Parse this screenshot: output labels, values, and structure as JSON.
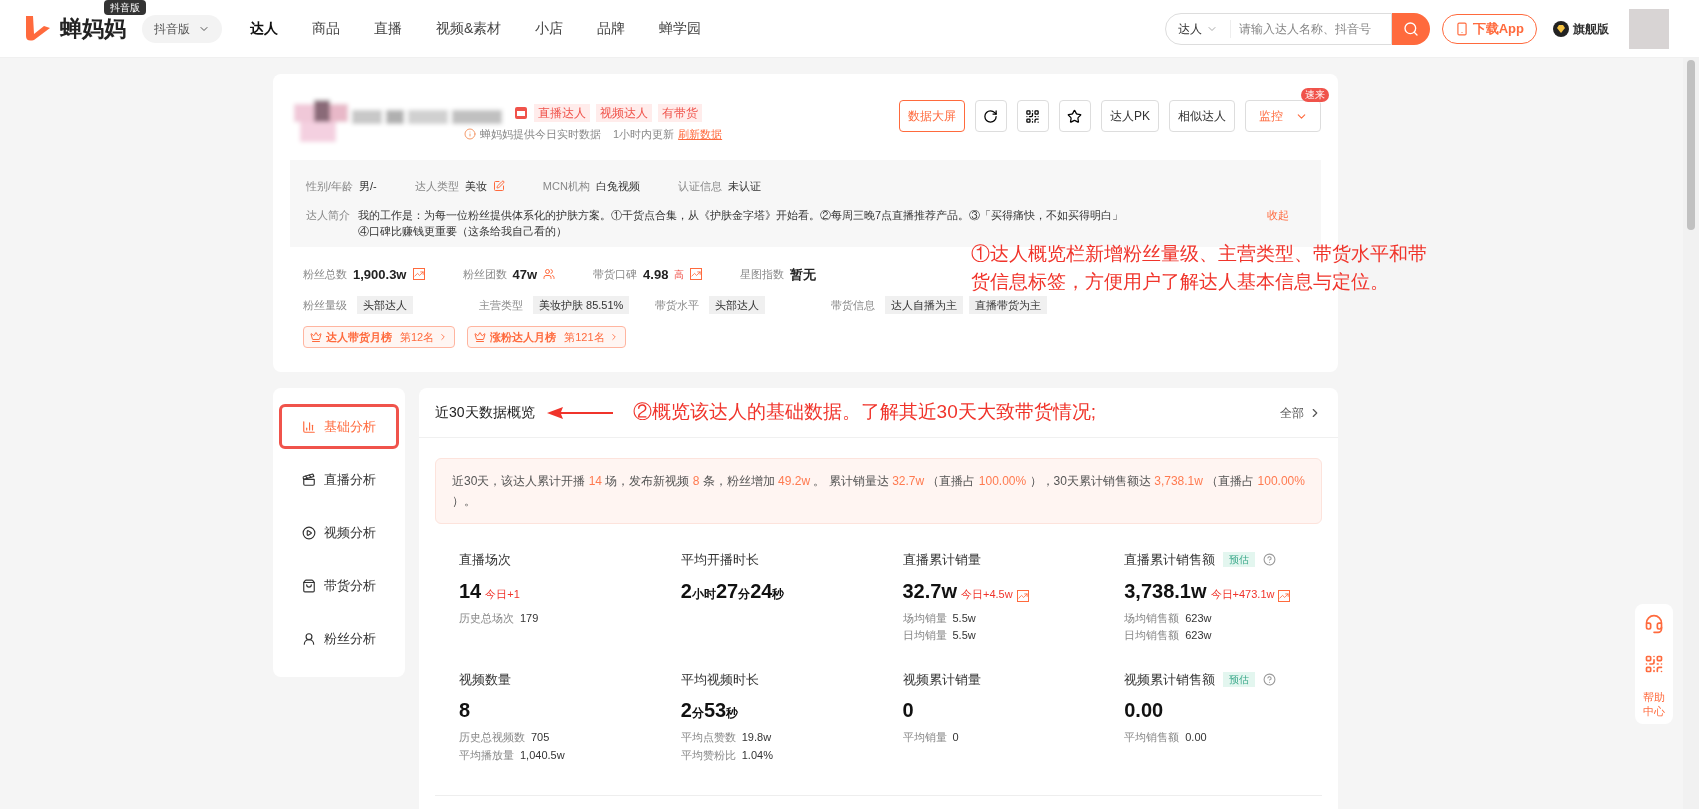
{
  "nav": {
    "logo": "蝉妈妈",
    "badge": "抖音版",
    "version": "抖音版",
    "items": [
      {
        "label": "达人",
        "selected": true
      },
      {
        "label": "商品",
        "selected": false
      },
      {
        "label": "直播",
        "selected": false
      },
      {
        "label": "视频&素材",
        "selected": false
      },
      {
        "label": "小店",
        "selected": false
      },
      {
        "label": "品牌",
        "selected": false
      },
      {
        "label": "蝉学园",
        "selected": false
      }
    ],
    "search_scope": "达人",
    "search_placeholder": "请输入达人名称、抖音号",
    "download": "下载App",
    "flagship": "旗舰版"
  },
  "profile": {
    "tags": [
      "直播达人",
      "视频达人",
      "有带货"
    ],
    "update_note": "蝉妈妈提供今日实时数据",
    "update_time": "1小时内更新",
    "refresh": "刷新数据",
    "actions": [
      {
        "label": "数据大屏",
        "kind": "primary"
      },
      {
        "kind": "refresh"
      },
      {
        "kind": "qr"
      },
      {
        "kind": "star"
      },
      {
        "label": "达人PK",
        "kind": "text"
      },
      {
        "label": "相似达人",
        "kind": "text"
      },
      {
        "label": "监控",
        "kind": "dropdown",
        "badge": "速来"
      }
    ],
    "info": [
      {
        "label": "性别/年龄",
        "value": "男/-"
      },
      {
        "label": "达人类型",
        "value": "美妆",
        "editable": true
      },
      {
        "label": "MCN机构",
        "value": "白兔视频"
      },
      {
        "label": "认证信息",
        "value": "未认证"
      }
    ],
    "intro_label": "达人简介",
    "intro": "我的工作是：为每一位粉丝提供体系化的护肤方案。①干货点合集，从《护肤金字塔》开始看。②每周三晚7点直播推荐产品。③「买得痛快，不如买得明白」④口碑比赚钱更重要（这条给我自己看的）",
    "collapse": "收起",
    "stats": [
      {
        "label": "粉丝总数",
        "value": "1,900.3w",
        "kind": "trend"
      },
      {
        "label": "粉丝团数",
        "value": "47w",
        "kind": "people"
      },
      {
        "label": "带货口碑",
        "value": "4.98",
        "level_tag": "高",
        "kind": "trend"
      },
      {
        "label": "星图指数",
        "value": "暂无",
        "kind": "plain"
      }
    ],
    "tag_groups": [
      {
        "label": "粉丝量级",
        "tags": [
          "头部达人"
        ]
      },
      {
        "label": "主营类型",
        "tags": [
          "美妆护肤 85.51%"
        ]
      },
      {
        "label": "带货水平",
        "tags": [
          "头部达人"
        ]
      },
      {
        "label": "带货信息",
        "tags": [
          "达人自播为主",
          "直播带货为主"
        ]
      }
    ],
    "ranks": [
      {
        "name": "达人带货月榜",
        "rank": "第12名"
      },
      {
        "name": "涨粉达人月榜",
        "rank": "第121名"
      }
    ]
  },
  "annotations": [
    {
      "text": "①达人概览栏新增粉丝量级、主营类型、带货水平和带货信息标签，方便用户了解达人基本信息与定位。"
    },
    {
      "text": "②概览该达人的基础数据。了解其近30天大致带货情况;"
    }
  ],
  "sidebar": [
    {
      "label": "基础分析",
      "kind": "chart",
      "selected": true
    },
    {
      "label": "直播分析",
      "kind": "live",
      "selected": false
    },
    {
      "label": "视频分析",
      "kind": "play",
      "selected": false
    },
    {
      "label": "带货分析",
      "kind": "bag",
      "selected": false
    },
    {
      "label": "粉丝分析",
      "kind": "user",
      "selected": false
    }
  ],
  "overview": {
    "title": "近30天数据概览",
    "all": "全部",
    "summary": [
      {
        "text": "近30天，该达人累计开播 "
      },
      {
        "text": "14",
        "highlight": true
      },
      {
        "text": " 场，发布新视频 "
      },
      {
        "text": "8",
        "highlight": true
      },
      {
        "text": " 条，粉丝增加 "
      },
      {
        "text": "49.2w",
        "highlight": true
      },
      {
        "text": " 。 累计销量达 "
      },
      {
        "text": "32.7w",
        "highlight": true
      },
      {
        "text": " （直播占 "
      },
      {
        "text": "100.00%",
        "highlight": true
      },
      {
        "text": " ），30天累计销售额达 "
      },
      {
        "text": "3,738.1w",
        "highlight": true
      },
      {
        "text": " （直播占 "
      },
      {
        "text": "100.00%",
        "highlight": true
      },
      {
        "text": " ）。"
      }
    ],
    "metrics": [
      {
        "label": "直播场次",
        "value": [
          {
            "text": "14",
            "kind": "num"
          }
        ],
        "today": "今日+1",
        "sub": [
          {
            "label": "历史总场次",
            "value": "179"
          }
        ]
      },
      {
        "label": "平均开播时长",
        "value": [
          {
            "text": "2",
            "kind": "num"
          },
          {
            "text": "小时",
            "kind": "unit"
          },
          {
            "text": "27",
            "kind": "num"
          },
          {
            "text": "分",
            "kind": "unit"
          },
          {
            "text": "24",
            "kind": "num"
          },
          {
            "text": "秒",
            "kind": "unit"
          }
        ]
      },
      {
        "label": "直播累计销量",
        "value": [
          {
            "text": "32.7w",
            "kind": "num"
          }
        ],
        "today": "今日+4.5w",
        "trend": true,
        "sub": [
          {
            "label": "场均销量",
            "value": "5.5w"
          },
          {
            "label": "日均销量",
            "value": "5.5w"
          }
        ]
      },
      {
        "label": "直播累计销售额",
        "estimate": "预估",
        "help": true,
        "value": [
          {
            "text": "3,738.1w",
            "kind": "num"
          }
        ],
        "today": "今日+473.1w",
        "trend": true,
        "sub": [
          {
            "label": "场均销售额",
            "value": "623w"
          },
          {
            "label": "日均销售额",
            "value": "623w"
          }
        ]
      },
      {
        "label": "视频数量",
        "value": [
          {
            "text": "8",
            "kind": "num"
          }
        ],
        "sub": [
          {
            "label": "历史总视频数",
            "value": "705"
          },
          {
            "label": "平均播放量",
            "value": "1,040.5w"
          }
        ]
      },
      {
        "label": "平均视频时长",
        "value": [
          {
            "text": "2",
            "kind": "num"
          },
          {
            "text": "分",
            "kind": "unit"
          },
          {
            "text": "53",
            "kind": "num"
          },
          {
            "text": "秒",
            "kind": "unit"
          }
        ],
        "sub": [
          {
            "label": "平均点赞数",
            "value": "19.8w"
          },
          {
            "label": "平均赞粉比",
            "value": "1.04%"
          }
        ]
      },
      {
        "label": "视频累计销量",
        "value": [
          {
            "text": "0",
            "kind": "num"
          }
        ],
        "sub": [
          {
            "label": "平均销量",
            "value": "0"
          }
        ]
      },
      {
        "label": "视频累计销售额",
        "estimate": "预估",
        "help": true,
        "value": [
          {
            "text": "0.00",
            "kind": "num"
          }
        ],
        "sub": [
          {
            "label": "平均销售额",
            "value": "0.00"
          }
        ]
      }
    ]
  },
  "float": {
    "help": "帮助中心"
  }
}
